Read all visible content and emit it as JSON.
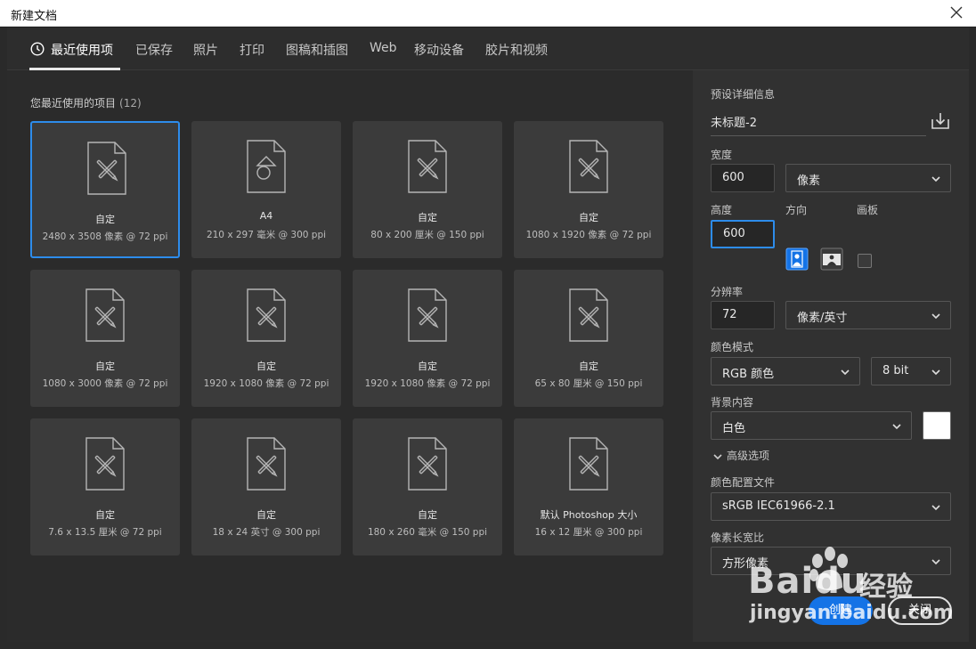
{
  "window": {
    "title": "新建文档"
  },
  "tabs": [
    {
      "label": "最近使用项",
      "active": true
    },
    {
      "label": "已保存"
    },
    {
      "label": "照片"
    },
    {
      "label": "打印"
    },
    {
      "label": "图稿和插图"
    },
    {
      "label": "Web"
    },
    {
      "label": "移动设备"
    },
    {
      "label": "胶片和视频"
    }
  ],
  "recent": {
    "title": "您最近使用的项目",
    "count": "(12)",
    "items": [
      {
        "name": "自定",
        "dims": "2480 x 3508 像素 @ 72 ppi",
        "selected": true,
        "icon": "custom-doc-icon"
      },
      {
        "name": "A4",
        "dims": "210 x 297 毫米 @ 300 ppi",
        "icon": "a4-doc-icon"
      },
      {
        "name": "自定",
        "dims": "80 x 200 厘米 @ 150 ppi",
        "icon": "custom-doc-icon"
      },
      {
        "name": "自定",
        "dims": "1080 x 1920 像素 @ 72 ppi",
        "icon": "custom-doc-icon"
      },
      {
        "name": "自定",
        "dims": "1080 x 3000 像素 @ 72 ppi",
        "icon": "custom-doc-icon"
      },
      {
        "name": "自定",
        "dims": "1920 x 1080 像素 @ 72 ppi",
        "icon": "custom-doc-icon"
      },
      {
        "name": "自定",
        "dims": "1920 x 1080 像素 @ 72 ppi",
        "icon": "custom-doc-icon"
      },
      {
        "name": "自定",
        "dims": "65 x 80 厘米 @ 150 ppi",
        "icon": "custom-doc-icon"
      },
      {
        "name": "自定",
        "dims": "7.6 x 13.5 厘米 @ 72 ppi",
        "icon": "custom-doc-icon"
      },
      {
        "name": "自定",
        "dims": "18 x 24 英寸 @ 300 ppi",
        "icon": "custom-doc-icon"
      },
      {
        "name": "自定",
        "dims": "180 x 260 毫米 @ 150 ppi",
        "icon": "custom-doc-icon"
      },
      {
        "name": "默认 Photoshop 大小",
        "dims": "16 x 12 厘米 @ 300 ppi",
        "icon": "custom-doc-icon"
      }
    ]
  },
  "details": {
    "title": "预设详细信息",
    "doc_name": "未标题-2",
    "width_label": "宽度",
    "width_value": "600",
    "unit": "像素",
    "height_label": "高度",
    "height_value": "600",
    "orientation_label": "方向",
    "artboard_label": "画板",
    "resolution_label": "分辨率",
    "resolution_value": "72",
    "resolution_unit": "像素/英寸",
    "color_mode_label": "颜色模式",
    "color_mode": "RGB 颜色",
    "bit_depth": "8 bit",
    "background_label": "背景内容",
    "background": "白色",
    "background_color": "#ffffff",
    "advanced_label": "高级选项",
    "color_profile_label": "颜色配置文件",
    "color_profile": "sRGB IEC61966-2.1",
    "pixel_aspect_label": "像素长宽比",
    "pixel_aspect": "方形像素"
  },
  "buttons": {
    "create": "创建",
    "close": "关闭"
  },
  "watermark": {
    "brand": "Baidu",
    "jingyan": "经验",
    "url": "jingyan.baidu.com"
  },
  "colors": {
    "accent": "#2d8ceb",
    "create_button": "#1473e6"
  }
}
